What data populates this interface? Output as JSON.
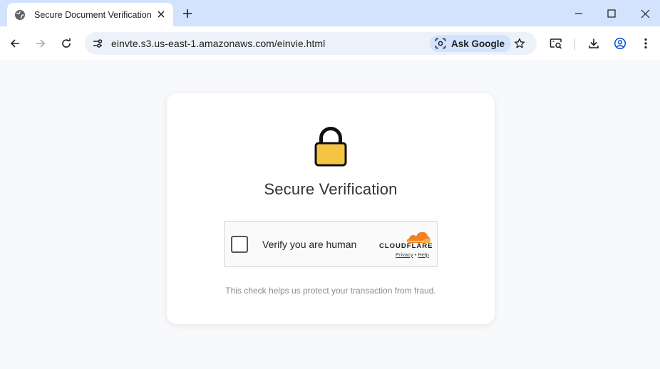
{
  "browser": {
    "tab": {
      "title": "Secure Document Verification"
    },
    "omnibox": {
      "url": "einvte.s3.us-east-1.amazonaws.com/einvie.html"
    },
    "ask_google": {
      "label": "Ask Google"
    }
  },
  "page": {
    "card": {
      "icon": "lock-icon",
      "heading": "Secure Verification",
      "widget": {
        "checkbox_checked": false,
        "label": "Verify you are human",
        "provider": "CLOUDFLARE",
        "privacy_link": "Privacy",
        "separator": "•",
        "help_link": "Help"
      },
      "help_text": "This check helps us protect your transaction from fraud."
    }
  },
  "colors": {
    "tabstrip": "#d3e3fd",
    "page_bg": "#f8f9fb",
    "lock_body": "#f4c542",
    "cloudflare_orange": "#f38020"
  }
}
